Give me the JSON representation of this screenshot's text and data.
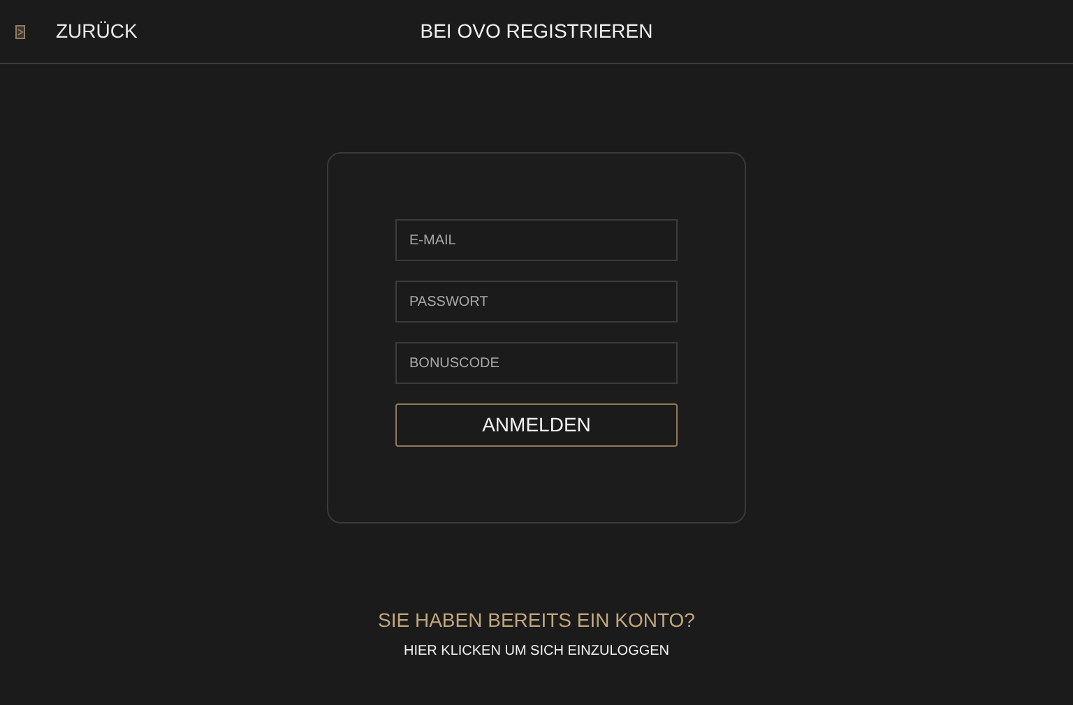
{
  "header": {
    "back_label": "ZURÜCK",
    "title": "BEI OVO REGISTRIEREN"
  },
  "form": {
    "fields": [
      {
        "placeholder": "E-MAIL"
      },
      {
        "placeholder": "PASSWORT"
      },
      {
        "placeholder": "BONUSCODE"
      }
    ],
    "submit": "ANMELDEN"
  },
  "footer": {
    "question": "SIE HABEN BEREITS EIN KONTO?",
    "link": "HIER KLICKEN UM SICH EINZULOGGEN"
  }
}
